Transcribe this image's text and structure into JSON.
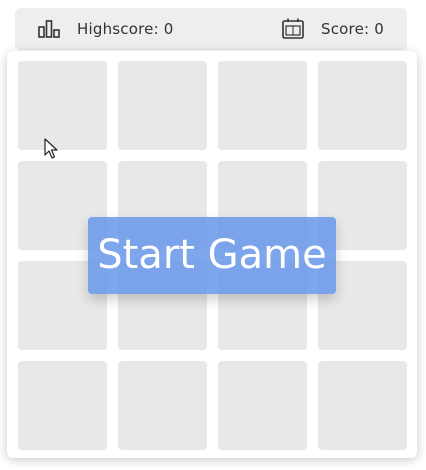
{
  "header": {
    "highscore": {
      "label": "Highscore: 0",
      "icon": "bar-chart-icon"
    },
    "score": {
      "label": "Score: 0",
      "icon": "scoreboard-icon"
    }
  },
  "board": {
    "grid_size": [
      4,
      4
    ],
    "tile_color": "#e8e8e8"
  },
  "start_button": {
    "label": "Start Game",
    "color": "#6696ea"
  },
  "cursor": {
    "icon": "mouse-pointer-icon"
  }
}
